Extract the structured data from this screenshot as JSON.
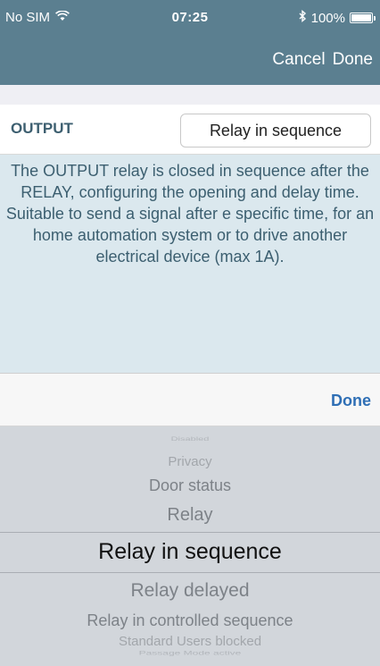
{
  "status_bar": {
    "carrier": "No SIM",
    "time": "07:25",
    "battery": "100%"
  },
  "nav": {
    "cancel_label": "Cancel",
    "done_label": "Done"
  },
  "output": {
    "label": "OUTPUT",
    "value": "Relay in sequence"
  },
  "description": "The OUTPUT relay is closed in sequence after the RELAY, configuring the opening and delay time. Suitable to send a signal after e specific time, for an home automation system or to drive another electrical device (max 1A).",
  "toolbar": {
    "done_label": "Done"
  },
  "picker": {
    "options": [
      "Disabled",
      "Privacy",
      "Door status",
      "Relay",
      "Relay in sequence",
      "Relay delayed",
      "Relay in controlled sequence",
      "Standard Users blocked",
      "Passage Mode active"
    ],
    "selected": "Relay in sequence"
  },
  "colors": {
    "header": "#5b7f90",
    "description_bg": "#dbe8ee",
    "label_text": "#3d5f70",
    "link_blue": "#2f6fb5",
    "picker_bg": "#d2d6db"
  }
}
